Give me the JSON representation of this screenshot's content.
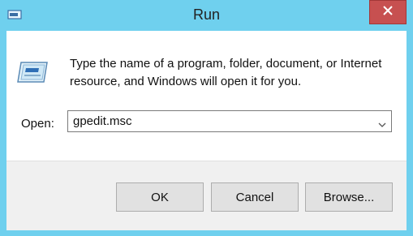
{
  "window": {
    "title": "Run",
    "title_icon": "run-icon",
    "close_icon": "close-icon",
    "accent_color": "#6fd0ee",
    "close_color": "#c75050"
  },
  "dialog": {
    "icon": "run-program-icon",
    "description": "Type the name of a program, folder, document, or Internet resource, and Windows will open it for you.",
    "open_label": "Open:",
    "open_value": "gpedit.msc",
    "dropdown_icon": "chevron-down-icon"
  },
  "buttons": {
    "ok": "OK",
    "cancel": "Cancel",
    "browse": "Browse..."
  }
}
